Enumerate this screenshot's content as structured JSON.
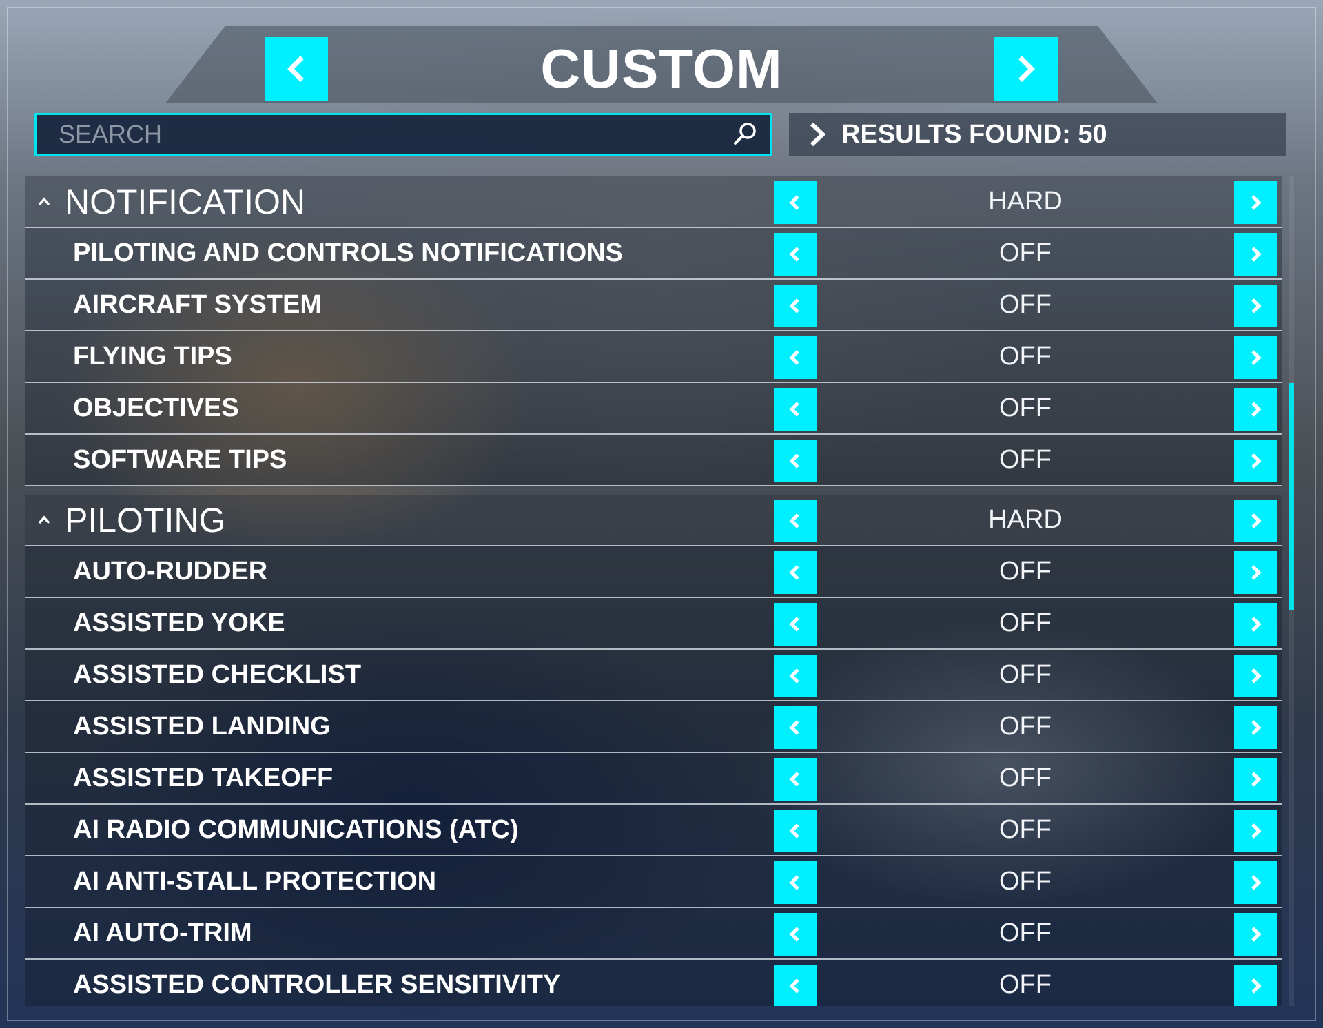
{
  "header": {
    "title": "CUSTOM"
  },
  "search": {
    "placeholder": "SEARCH",
    "value": ""
  },
  "results": {
    "text": "RESULTS FOUND: 50"
  },
  "colors": {
    "accent": "#00f0ff",
    "text": "#ffffff"
  },
  "sections": [
    {
      "title": "NOTIFICATION",
      "value": "HARD",
      "items": [
        {
          "label": "PILOTING AND CONTROLS NOTIFICATIONS",
          "value": "OFF"
        },
        {
          "label": "AIRCRAFT SYSTEM",
          "value": "OFF"
        },
        {
          "label": "FLYING TIPS",
          "value": "OFF"
        },
        {
          "label": "OBJECTIVES",
          "value": "OFF"
        },
        {
          "label": "SOFTWARE TIPS",
          "value": "OFF"
        }
      ]
    },
    {
      "title": "PILOTING",
      "value": "HARD",
      "items": [
        {
          "label": "AUTO-RUDDER",
          "value": "OFF"
        },
        {
          "label": "ASSISTED YOKE",
          "value": "OFF"
        },
        {
          "label": "ASSISTED CHECKLIST",
          "value": "OFF"
        },
        {
          "label": "ASSISTED LANDING",
          "value": "OFF"
        },
        {
          "label": "ASSISTED TAKEOFF",
          "value": "OFF"
        },
        {
          "label": "AI RADIO COMMUNICATIONS (ATC)",
          "value": "OFF"
        },
        {
          "label": "AI ANTI-STALL PROTECTION",
          "value": "OFF"
        },
        {
          "label": "AI AUTO-TRIM",
          "value": "OFF"
        },
        {
          "label": "ASSISTED CONTROLLER SENSITIVITY",
          "value": "OFF"
        }
      ]
    }
  ]
}
